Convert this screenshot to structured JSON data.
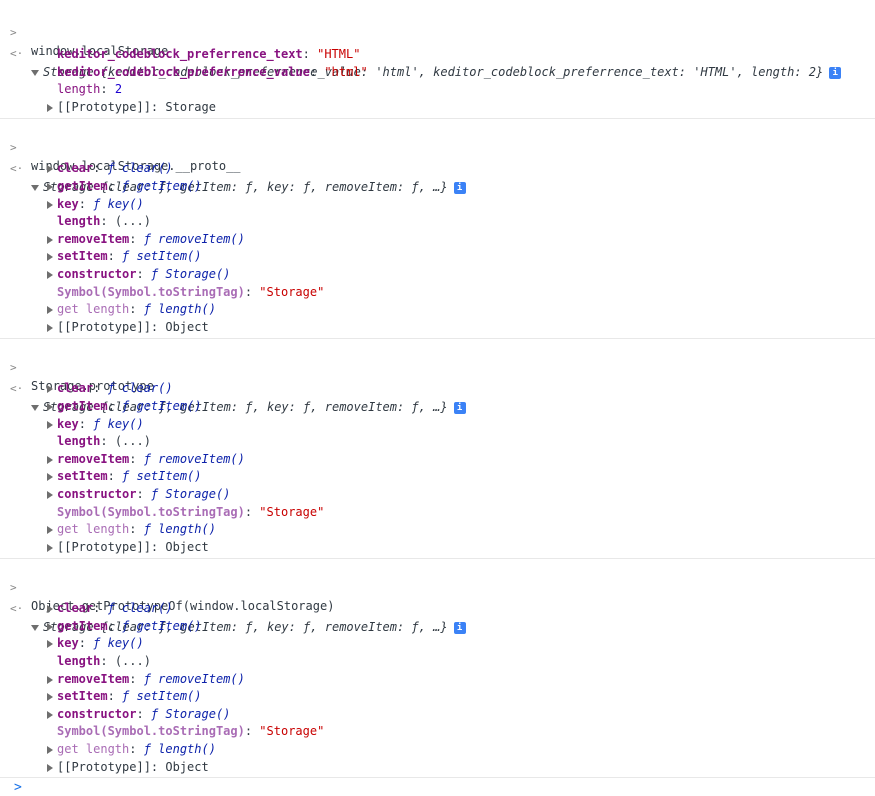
{
  "entries": [
    {
      "input": "window.localStorage",
      "summary": "Storage {keditor_codeblock_preferrence_value: 'html', keditor_codeblock_preferrence_text: 'HTML', length: 2}",
      "rows": [
        {
          "key": "keditor_codeblock_preferrence_text",
          "sep": ": ",
          "value": "\"HTML\""
        },
        {
          "key": "keditor_codeblock_preferrence_value",
          "sep": ": ",
          "value": "\"html\""
        },
        {
          "key": "length",
          "sep": ": ",
          "value": "2"
        },
        {
          "key": "[[Prototype]]",
          "sep": ": ",
          "value": "Storage"
        }
      ]
    },
    {
      "input": "window.localStorage.__proto__",
      "summary": "Storage {clear: ƒ, getItem: ƒ, key: ƒ, removeItem: ƒ, …}",
      "rows": [
        {
          "key": "clear",
          "value": "ƒ clear()"
        },
        {
          "key": "getItem",
          "value": "ƒ getItem()"
        },
        {
          "key": "key",
          "value": "ƒ key()"
        },
        {
          "key": "length",
          "value": "(...)"
        },
        {
          "key": "removeItem",
          "value": "ƒ removeItem()"
        },
        {
          "key": "setItem",
          "value": "ƒ setItem()"
        },
        {
          "key": "constructor",
          "value": "ƒ Storage()"
        },
        {
          "key": "Symbol(Symbol.toStringTag)",
          "value": "\"Storage\""
        },
        {
          "key": "get length",
          "value": "ƒ length()"
        },
        {
          "key": "[[Prototype]]",
          "value": "Object"
        }
      ]
    },
    {
      "input": "Storage.prototype",
      "summary": "Storage {clear: ƒ, getItem: ƒ, key: ƒ, removeItem: ƒ, …}",
      "rows": [
        {
          "key": "clear",
          "value": "ƒ clear()"
        },
        {
          "key": "getItem",
          "value": "ƒ getItem()"
        },
        {
          "key": "key",
          "value": "ƒ key()"
        },
        {
          "key": "length",
          "value": "(...)"
        },
        {
          "key": "removeItem",
          "value": "ƒ removeItem()"
        },
        {
          "key": "setItem",
          "value": "ƒ setItem()"
        },
        {
          "key": "constructor",
          "value": "ƒ Storage()"
        },
        {
          "key": "Symbol(Symbol.toStringTag)",
          "value": "\"Storage\""
        },
        {
          "key": "get length",
          "value": "ƒ length()"
        },
        {
          "key": "[[Prototype]]",
          "value": "Object"
        }
      ]
    },
    {
      "input": "Object.getPrototypeOf(window.localStorage)",
      "summary": "Storage {clear: ƒ, getItem: ƒ, key: ƒ, removeItem: ƒ, …}",
      "rows": [
        {
          "key": "clear",
          "value": "ƒ clear()"
        },
        {
          "key": "getItem",
          "value": "ƒ getItem()"
        },
        {
          "key": "key",
          "value": "ƒ key()"
        },
        {
          "key": "length",
          "value": "(...)"
        },
        {
          "key": "removeItem",
          "value": "ƒ removeItem()"
        },
        {
          "key": "setItem",
          "value": "ƒ setItem()"
        },
        {
          "key": "constructor",
          "value": "ƒ Storage()"
        },
        {
          "key": "Symbol(Symbol.toStringTag)",
          "value": "\"Storage\""
        },
        {
          "key": "get length",
          "value": "ƒ length()"
        },
        {
          "key": "[[Prototype]]",
          "value": "Object"
        }
      ]
    }
  ],
  "icons": {
    "input_prompt": "chevron-right-icon",
    "output_prompt": "return-arrow-icon",
    "info": "info-icon"
  },
  "symbols": {
    "input_prompt": ">",
    "output_prompt": "<·",
    "info": "i",
    "prompt": ">"
  }
}
